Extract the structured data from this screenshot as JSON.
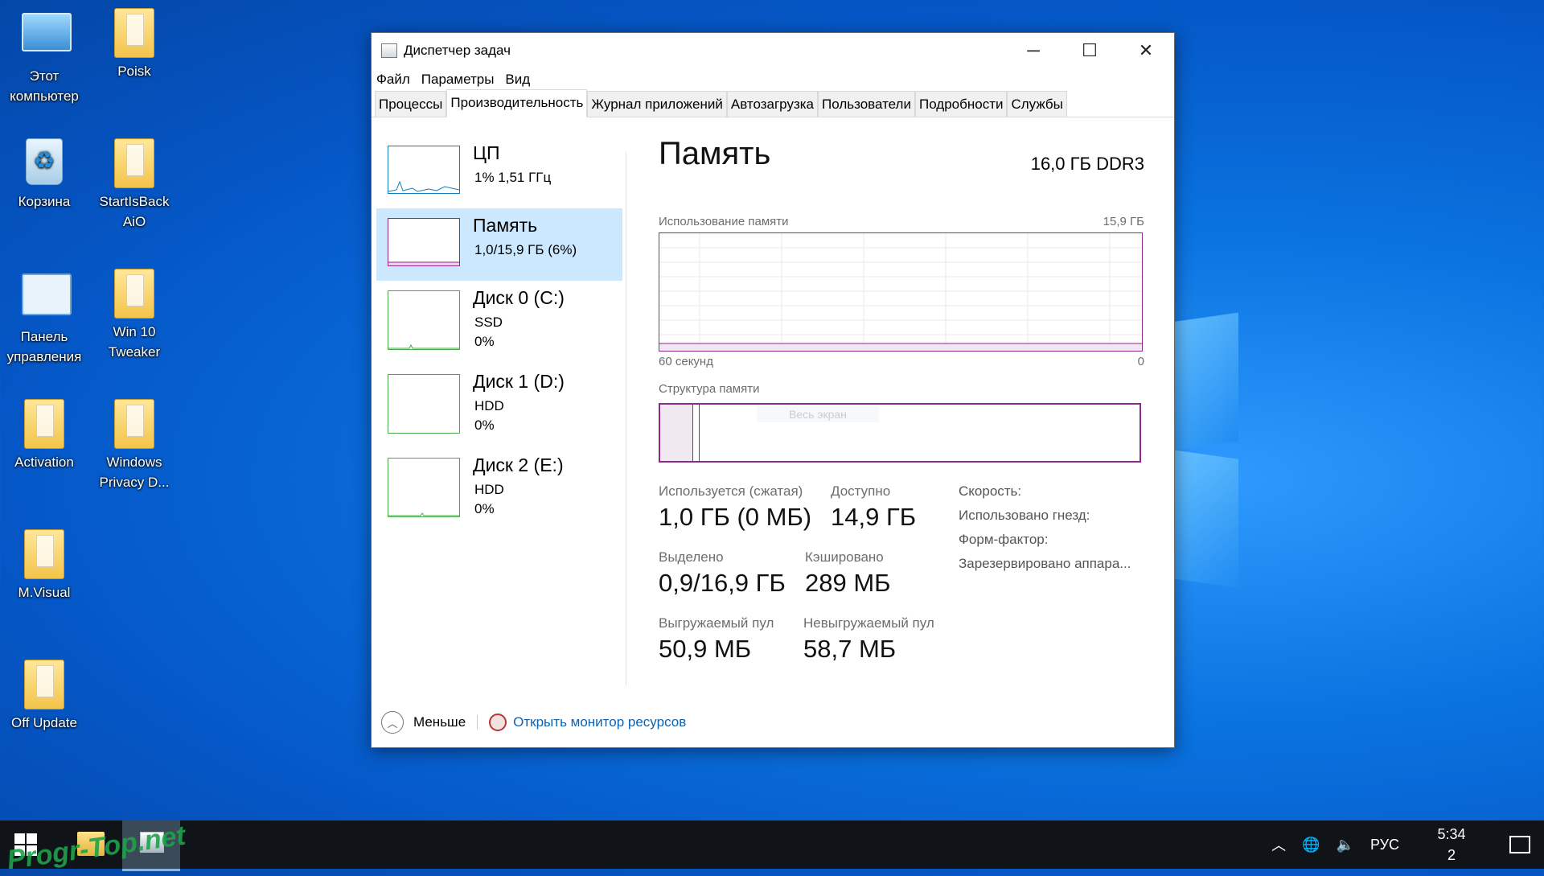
{
  "desktop": {
    "icons": [
      {
        "label_line1": "Этот",
        "label_line2": "компьютер",
        "icon": "computer-icon"
      },
      {
        "label_line1": "Poisk",
        "label_line2": "",
        "icon": "folder-icon"
      },
      {
        "label_line1": "Корзина",
        "label_line2": "",
        "icon": "recycle-bin-icon"
      },
      {
        "label_line1": "StartIsBack",
        "label_line2": "AiO",
        "icon": "folder-icon"
      },
      {
        "label_line1": "Панель",
        "label_line2": "управления",
        "icon": "control-panel-icon"
      },
      {
        "label_line1": "Win 10",
        "label_line2": "Tweaker",
        "icon": "folder-icon"
      },
      {
        "label_line1": "Activation",
        "label_line2": "",
        "icon": "folder-icon"
      },
      {
        "label_line1": "Windows",
        "label_line2": "Privacy D...",
        "icon": "folder-icon"
      },
      {
        "label_line1": "M.Visual",
        "label_line2": "",
        "icon": "folder-icon"
      },
      {
        "label_line1": "Off Update",
        "label_line2": "",
        "icon": "folder-icon"
      }
    ]
  },
  "window": {
    "title": "Диспетчер задач",
    "menu": [
      "Файл",
      "Параметры",
      "Вид"
    ],
    "tabs": [
      "Процессы",
      "Производительность",
      "Журнал приложений",
      "Автозагрузка",
      "Пользователи",
      "Подробности",
      "Службы"
    ],
    "active_tab": "Производительность",
    "sidebar": [
      {
        "name": "ЦП",
        "line1": "1%  1,51 ГГц",
        "line2": ""
      },
      {
        "name": "Память",
        "line1": "1,0/15,9 ГБ (6%)",
        "line2": ""
      },
      {
        "name": "Диск 0 (C:)",
        "line1": "SSD",
        "line2": "0%"
      },
      {
        "name": "Диск 1 (D:)",
        "line1": "HDD",
        "line2": "0%"
      },
      {
        "name": "Диск 2 (E:)",
        "line1": "HDD",
        "line2": "0%"
      }
    ],
    "main": {
      "title": "Память",
      "type": "16,0 ГБ DDR3",
      "usage_label": "Использование памяти",
      "usage_max": "15,9 ГБ",
      "time_label": "60 секунд",
      "time_end": "0",
      "structure_label": "Структура памяти",
      "structure_overlay": "Весь экран",
      "stats": {
        "in_use_label": "Используется (сжатая)",
        "in_use_value": "1,0 ГБ (0 МБ)",
        "available_label": "Доступно",
        "available_value": "14,9 ГБ",
        "committed_label": "Выделено",
        "committed_value": "0,9/16,9 ГБ",
        "cached_label": "Кэшировано",
        "cached_value": "289 МБ",
        "paged_label": "Выгружаемый пул",
        "paged_value": "50,9 МБ",
        "nonpaged_label": "Невыгружаемый пул",
        "nonpaged_value": "58,7 МБ"
      },
      "right_labels": [
        "Скорость:",
        "Использовано гнезд:",
        "Форм-фактор:",
        "Зарезервировано аппара..."
      ]
    },
    "footer": {
      "less_label": "Меньше",
      "monitor_link": "Открыть монитор ресурсов"
    }
  },
  "taskbar": {
    "lang": "РУС",
    "time": "5:34",
    "date_fragment": "2"
  },
  "watermark": "Progr-Top.net",
  "colors": {
    "memory": "#8b2a8b",
    "cpu": "#117dbb",
    "disk": "#4aa84a",
    "accent": "#0078d7"
  }
}
